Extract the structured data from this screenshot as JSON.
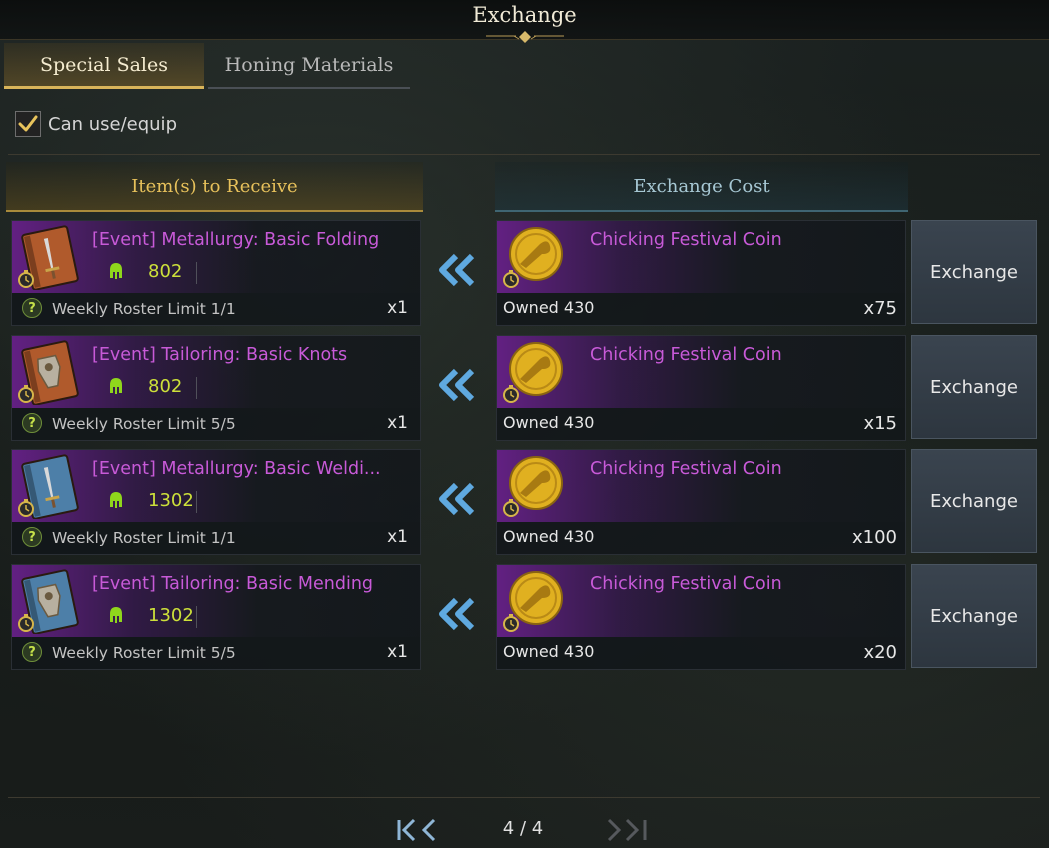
{
  "window": {
    "title": "Exchange"
  },
  "tabs": [
    {
      "label": "Special Sales",
      "active": true
    },
    {
      "label": "Honing Materials",
      "active": false
    }
  ],
  "filter": {
    "label": "Can use/equip",
    "checked": true
  },
  "headers": {
    "receive": "Item(s) to Receive",
    "cost": "Exchange Cost"
  },
  "rows": [
    {
      "item": {
        "name": "[Event] Metallurgy: Basic Folding",
        "ilvl": "802",
        "limit": "Weekly Roster Limit 1/1",
        "qty": "x1",
        "icon": "book-sword-icon",
        "icon_color": "#b05a2c"
      },
      "cost": {
        "currency": "Chicking Festival Coin",
        "owned": "Owned 430",
        "qty": "x75",
        "icon": "gold-coin-icon"
      },
      "button": "Exchange"
    },
    {
      "item": {
        "name": "[Event] Tailoring: Basic Knots",
        "ilvl": "802",
        "limit": "Weekly Roster Limit 5/5",
        "qty": "x1",
        "icon": "book-armor-icon",
        "icon_color": "#b05a2c"
      },
      "cost": {
        "currency": "Chicking Festival Coin",
        "owned": "Owned 430",
        "qty": "x15",
        "icon": "gold-coin-icon"
      },
      "button": "Exchange"
    },
    {
      "item": {
        "name": "[Event] Metallurgy: Basic Weldi...",
        "ilvl": "1302",
        "limit": "Weekly Roster Limit 1/1",
        "qty": "x1",
        "icon": "book-sword-icon",
        "icon_color": "#4d7fa8"
      },
      "cost": {
        "currency": "Chicking Festival Coin",
        "owned": "Owned 430",
        "qty": "x100",
        "icon": "gold-coin-icon"
      },
      "button": "Exchange"
    },
    {
      "item": {
        "name": "[Event] Tailoring: Basic Mending",
        "ilvl": "1302",
        "limit": "Weekly Roster Limit 5/5",
        "qty": "x1",
        "icon": "book-armor-icon",
        "icon_color": "#4d7fa8"
      },
      "cost": {
        "currency": "Chicking Festival Coin",
        "owned": "Owned 430",
        "qty": "x20",
        "icon": "gold-coin-icon"
      },
      "button": "Exchange"
    }
  ],
  "pagination": {
    "text": "4 / 4"
  },
  "colors": {
    "item_name": "#c85ad8",
    "item_level": "#cde03a",
    "gold_accent": "#e7c15b",
    "teal_accent": "#a7c8d4"
  }
}
